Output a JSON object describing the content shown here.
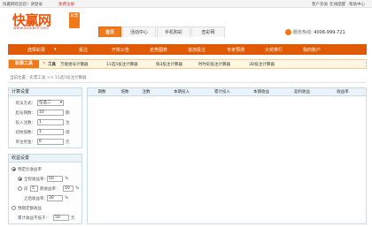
{
  "topbar": {
    "greeting": "快赢网欢迎您！请登录",
    "register": "免费注册",
    "links": [
      "客户充值",
      "在线提醒",
      "帮助中心"
    ]
  },
  "logo": {
    "name": "快赢网",
    "badge": "彩票",
    "url": "www.kuaiwin.com"
  },
  "nav": {
    "tabs": [
      "首页",
      "活动中心",
      "手机购彩",
      "查彩网"
    ],
    "active_index": 0
  },
  "hotline": {
    "label": "服务热线:",
    "number": "4006-999-721"
  },
  "menu": {
    "lottery_select": "选择彩票",
    "items": [
      "投注",
      "开奖公告",
      "走势图表",
      "追加投注",
      "专家预测",
      "大奖排行",
      "我的账户"
    ]
  },
  "toolstrip": {
    "tag": "彩票工具",
    "label": "工具",
    "items": [
      "万能组号计算器",
      "11选5投注计算器",
      "快3投注计算器",
      "时时彩投注计算器",
      "3D投注计算器"
    ]
  },
  "breadcrumb": "当前位置：彩票工具 >> 11选5投注计算器",
  "calc": {
    "title": "计算设置",
    "fields": [
      {
        "label": "玩法方式：",
        "value": "任选二",
        "unit": ""
      },
      {
        "label": "起号期数：",
        "value": "10",
        "unit": "期"
      },
      {
        "label": "投入注数：",
        "value": "1",
        "unit": "注"
      },
      {
        "label": "初始倍数：",
        "value": "1",
        "unit": "倍"
      },
      {
        "label": "单注奖金：",
        "value": "6",
        "unit": "元"
      }
    ]
  },
  "profit": {
    "title": "收益设置",
    "options": [
      {
        "label": "预定比收益率",
        "selected": true
      },
      {
        "label": "全程收益率：",
        "value": "50",
        "unit": "%",
        "selected": true
      },
      {
        "label": "前",
        "value": "5",
        "mid": "期收益率：",
        "value2": "10",
        "unit": "%",
        "selected": false
      },
      {
        "label": "之后收益率：",
        "value": "30",
        "unit": "%",
        "selected": false
      },
      {
        "label": "预期定额收益",
        "selected": false
      },
      {
        "label": "累计收益不低于：",
        "value": "50",
        "unit": "元"
      }
    ]
  },
  "table": {
    "headers": [
      "期数",
      "倍数",
      "注数",
      "本期投入",
      "累计投入",
      "本期收益",
      "盈利收益",
      "收益率"
    ]
  },
  "colors": {
    "brand": "#e8570e",
    "menubar": "#e05a06",
    "panel_head": "#eaf3fa"
  }
}
